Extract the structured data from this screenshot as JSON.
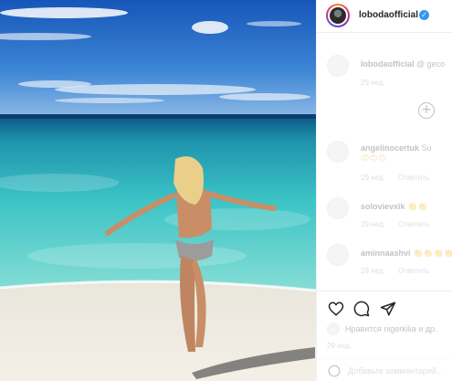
{
  "post": {
    "username": "lobodaofficial",
    "verified_mark": "✓",
    "avatar_icon": "profile-photo-icon"
  },
  "comments": [
    {
      "username": "lobodaofficial",
      "text": "@ geco",
      "time": "29 нед.",
      "likes": "",
      "reply": "",
      "emoji": ""
    },
    {
      "username": "angelinocertuk",
      "text": "Su",
      "time": "29 нед.",
      "likes": "",
      "reply": "Ответить",
      "emoji": "😍😍😍"
    },
    {
      "username": "solovievxik",
      "text": "👏👏",
      "time": "29 нед.",
      "likes": "",
      "reply": "Ответить",
      "emoji": ""
    },
    {
      "username": "aminnaashvi",
      "text": "👏👏👏👏",
      "time": "29 нед.",
      "likes": "",
      "reply": "Ответить",
      "emoji": ""
    }
  ],
  "load_more_symbol": "+",
  "liked_by": {
    "text": "Нравится nigerkilia и др.",
    "date": "29 нед."
  },
  "add_comment": {
    "placeholder": "Добавьте комментарий..."
  },
  "colors": {
    "sky_top": "#1a5fbf",
    "sky_bottom": "#6aa6e0",
    "sea_deep": "#0f6f8f",
    "sea_shallow": "#3cc7c9",
    "sand": "#f2ece3",
    "verified": "#3897f0"
  }
}
